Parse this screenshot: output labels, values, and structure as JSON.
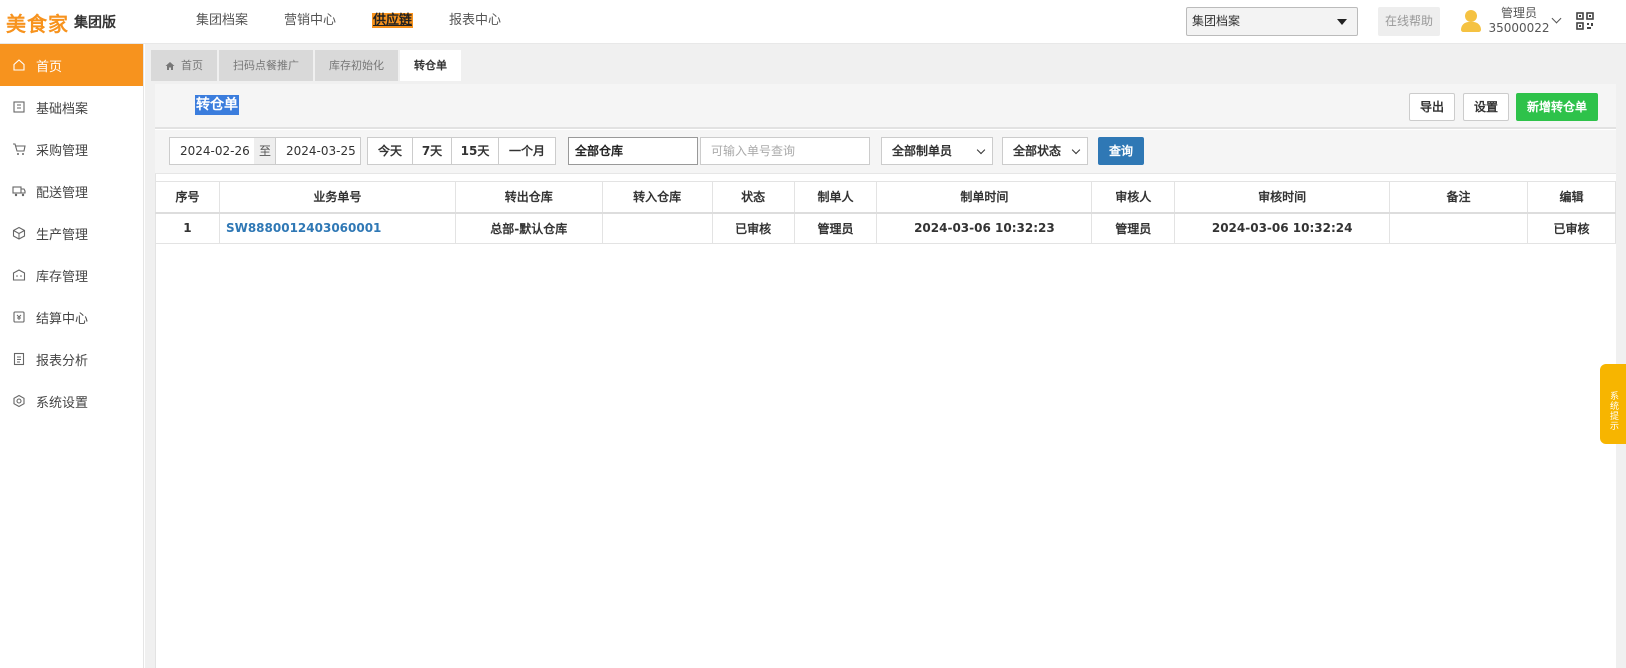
{
  "header": {
    "brand": "美食家",
    "edition": "集团版",
    "nav": [
      {
        "label": "集团档案"
      },
      {
        "label": "营销中心"
      },
      {
        "label": "供应链"
      },
      {
        "label": "报表中心"
      }
    ],
    "group_select": "集团档案",
    "help_label": "在线帮助",
    "user_name": "管理员",
    "user_id": "35000022"
  },
  "sidebar": {
    "items": [
      {
        "label": "首页",
        "icon": "home-icon"
      },
      {
        "label": "基础档案",
        "icon": "archive-icon"
      },
      {
        "label": "采购管理",
        "icon": "cart-icon"
      },
      {
        "label": "配送管理",
        "icon": "truck-icon"
      },
      {
        "label": "生产管理",
        "icon": "cube-icon"
      },
      {
        "label": "库存管理",
        "icon": "warehouse-icon"
      },
      {
        "label": "结算中心",
        "icon": "bill-icon"
      },
      {
        "label": "报表分析",
        "icon": "report-icon"
      },
      {
        "label": "系统设置",
        "icon": "settings-icon"
      }
    ]
  },
  "tabs": [
    {
      "label": "首页"
    },
    {
      "label": "扫码点餐推广"
    },
    {
      "label": "库存初始化"
    },
    {
      "label": "转仓单"
    }
  ],
  "page": {
    "title": "转仓单",
    "export_label": "导出",
    "settings_label": "设置",
    "add_label": "新增转仓单"
  },
  "filters": {
    "date_from": "2024-02-26",
    "date_sep": "至",
    "date_to": "2024-03-25",
    "quick_ranges": [
      "今天",
      "7天",
      "15天",
      "一个月"
    ],
    "warehouse": "全部仓库",
    "search_placeholder": "可输入单号查询",
    "maker": "全部制单员",
    "status": "全部状态",
    "query_label": "查询"
  },
  "table": {
    "columns": [
      "序号",
      "业务单号",
      "转出仓库",
      "转入仓库",
      "状态",
      "制单人",
      "制单时间",
      "审核人",
      "审核时间",
      "备注",
      "编辑"
    ],
    "rows": [
      [
        "1",
        "SW8880012403060001",
        "总部-默认仓库",
        "",
        "已审核",
        "管理员",
        "2024-03-06 10:32:23",
        "管理员",
        "2024-03-06 10:32:24",
        "",
        "已审核"
      ]
    ]
  },
  "system_tip": "系统提示",
  "colors": {
    "accent": "#f7931e",
    "primary": "#2f78b5",
    "success": "#2ec24a",
    "tip": "#f7b500"
  }
}
